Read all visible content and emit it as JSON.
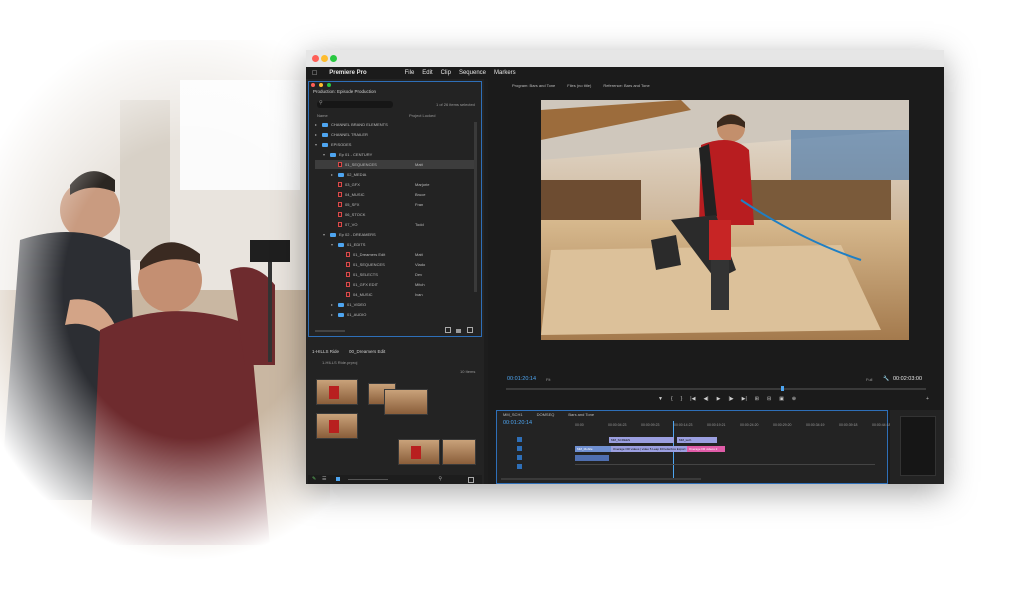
{
  "menubar": {
    "app_name": "Premiere Pro",
    "items": [
      "File",
      "Edit",
      "Clip",
      "Sequence",
      "Markers"
    ]
  },
  "project_panel": {
    "title": "Production: Episode Production",
    "item_count": "1 of 26 items selected",
    "col_name": "Name",
    "col_status": "Project Locked",
    "rows": [
      {
        "label": "CHANNEL BRAND ELEMENTS",
        "who": "",
        "type": "folder"
      },
      {
        "label": "CHANNEL TRAILER",
        "who": "",
        "type": "folder"
      },
      {
        "label": "EPISODES",
        "who": "",
        "type": "folder"
      },
      {
        "label": "Ep 01 - CENTURY",
        "who": "",
        "type": "folder"
      },
      {
        "label": "01_SEQUENCES",
        "who": "Matt",
        "type": "seq"
      },
      {
        "label": "02_MEDIA",
        "who": "",
        "type": "folder"
      },
      {
        "label": "03_GFX",
        "who": "Marjorie",
        "type": "seq"
      },
      {
        "label": "04_MUSIC",
        "who": "Bruce",
        "type": "seq"
      },
      {
        "label": "05_SFX",
        "who": "Fran",
        "type": "seq"
      },
      {
        "label": "06_STOCK",
        "who": "",
        "type": "seq"
      },
      {
        "label": "07_VO",
        "who": "Todd",
        "type": "seq"
      },
      {
        "label": "Ep 02 - DREAMERS",
        "who": "",
        "type": "folder"
      },
      {
        "label": "01_EDITS",
        "who": "",
        "type": "folder"
      },
      {
        "label": "01_Dreamers Edit",
        "who": "Matt",
        "type": "seq"
      },
      {
        "label": "01_SEQUENCES",
        "who": "Vlado",
        "type": "seq"
      },
      {
        "label": "01_SELECTS",
        "who": "Dev",
        "type": "seq"
      },
      {
        "label": "01_GFX EDIT",
        "who": "Mitch",
        "type": "seq"
      },
      {
        "label": "04_MUSIC",
        "who": "Ivan",
        "type": "seq"
      },
      {
        "label": "01_VIDEO",
        "who": "",
        "type": "folder"
      },
      {
        "label": "01_AUDIO",
        "who": "",
        "type": "folder"
      }
    ]
  },
  "bin_panel": {
    "tab1": "1-HILLS Ride",
    "tab2": "00_Dreamers Edit",
    "file": "1-HILLS Ride.prproj",
    "count": "10 Items"
  },
  "program": {
    "tab1": "Program: Bars and Tone",
    "tab2": "Files (no title)",
    "tab3": "Reference: Bars and Tone",
    "timecode_left": "00:01:20:14",
    "fit": "Fit",
    "full": "Full",
    "timecode_right": "00:02:03:00"
  },
  "timeline": {
    "tabs": [
      "MM_SCH1",
      "DOMSEQ",
      "Bars and Tone"
    ],
    "timecode": "00:01:20:14",
    "ruler": [
      "00:00",
      "00:00:04:23",
      "00:00:09:23",
      "00:00:14:23",
      "00:00:19:21",
      "00:00:24:20",
      "00:00:29:20",
      "00:00:34:19",
      "00:00:39:18",
      "00:00:44:18"
    ],
    "clips": [
      "MM_SCREEN",
      "MM_Mobile",
      "Overage OR videos | video 5 Leap Fill letterbox Export",
      "Overage FR videos 2",
      "MM_tech"
    ]
  }
}
